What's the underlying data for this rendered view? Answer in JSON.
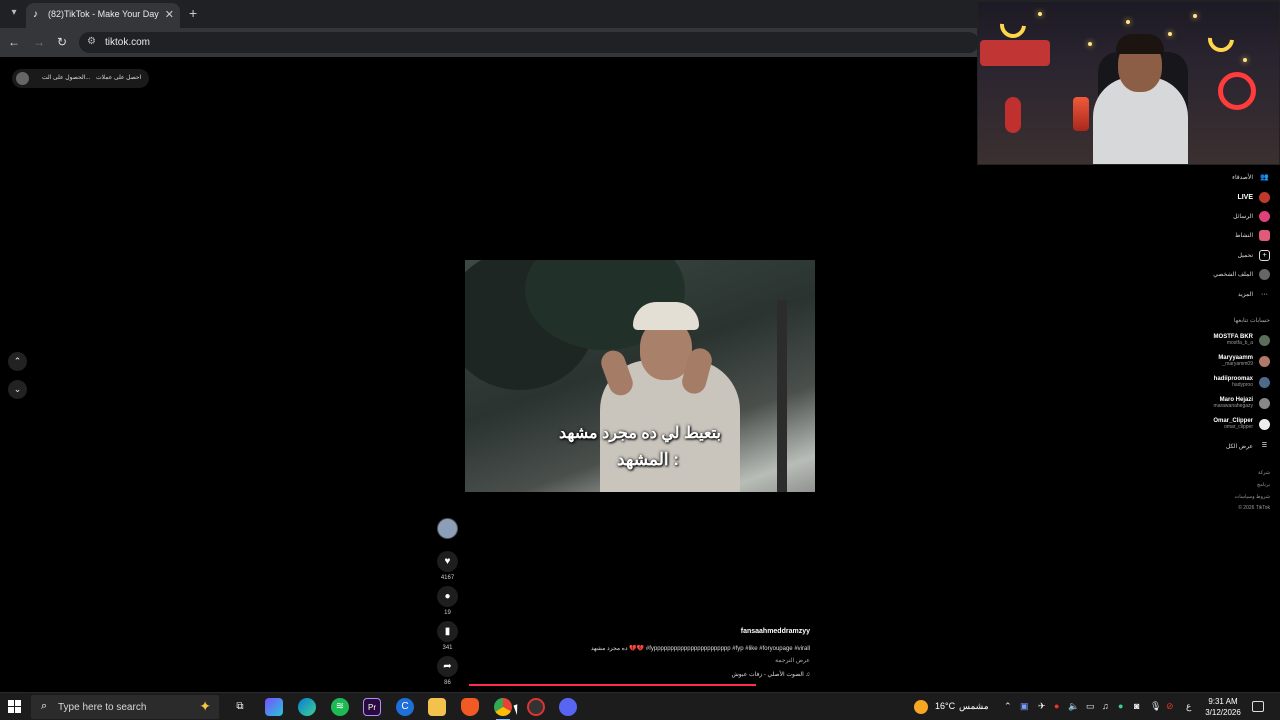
{
  "browser": {
    "tab_count_title": "(82)TikTok - Make Your Day",
    "new_tab_glyph": "+",
    "close_glyph": "✕",
    "url": "tiktok.com"
  },
  "top_pill": {
    "get_coins": "احصل على عملات",
    "get_app": "الحصول على الت..."
  },
  "video": {
    "caption_line1": "بتعيط لي ده مجرد مشهد",
    "caption_line2": "المشهد :"
  },
  "actions": {
    "likes": "4167",
    "comments": "19",
    "saves": "341",
    "shares": "86"
  },
  "meta": {
    "username": "fansaahmeddramzyy",
    "description": "ده مجرد مشهد 💔💔 #fyppppppppppppppppppppppp #fyp #like #foryoupage #virall",
    "see_translation": "عرض الترجمة",
    "sound": "الصوت الأصلي - زفات عبوش"
  },
  "sidebar": {
    "items": [
      {
        "label": "الأصدقاء",
        "icon": "friends-icon"
      },
      {
        "label": "LIVE",
        "icon": "live-icon"
      },
      {
        "label": "الرسائل",
        "icon": "messages-icon"
      },
      {
        "label": "النشاط",
        "icon": "activity-icon"
      },
      {
        "label": "تحميل",
        "icon": "upload-icon"
      },
      {
        "label": "الملف الشخصي",
        "icon": "profile-icon"
      },
      {
        "label": "المزيد",
        "icon": "more-icon"
      }
    ],
    "following_heading": "حسابات تتابعها",
    "following": [
      {
        "name": "MOSTFA BKR",
        "handle": "mostfa_b_a"
      },
      {
        "name": "Maryyaamm",
        "handle": "_maryamm09"
      },
      {
        "name": "hadiiproomax",
        "handle": "hadyproo"
      },
      {
        "name": "Maro Hejazi",
        "handle": "marawanahegazy"
      },
      {
        "name": "Omar_Clipper",
        "handle": "omar_clipper"
      }
    ],
    "see_all": "عرض الكل",
    "footer": [
      "شركة",
      "برنامج",
      "شروط وسياسات",
      "© 2026 TikTok"
    ]
  },
  "taskbar": {
    "search_placeholder": "Type here to search",
    "temperature": "16°C",
    "condition": "مشمس",
    "lang": "ع",
    "time": "9:31 AM",
    "date": "3/12/2026"
  }
}
